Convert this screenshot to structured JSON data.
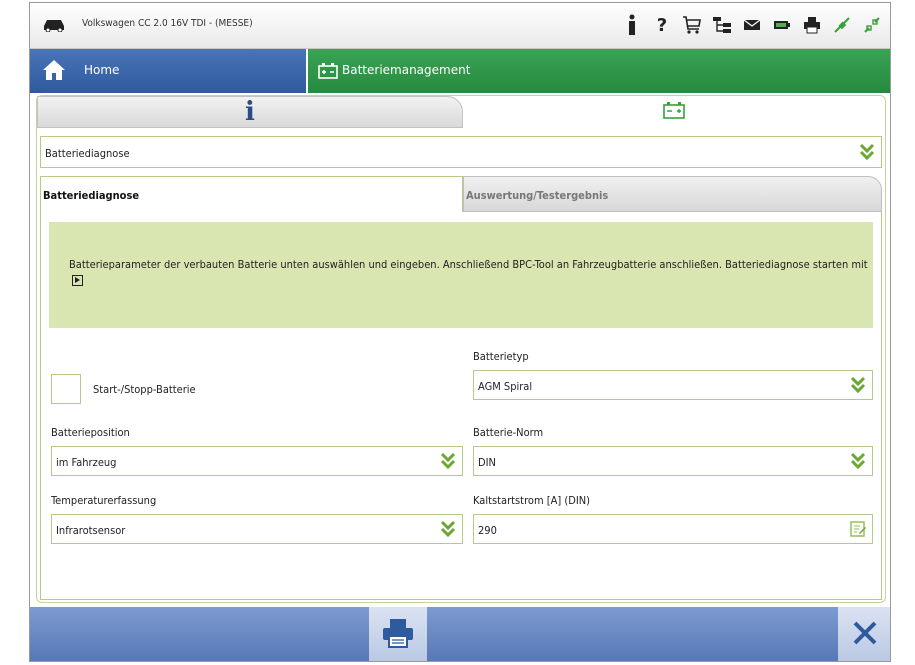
{
  "titlebar": {
    "vehicle": "Volkswagen CC 2.0 16V TDI - (MESSE)",
    "icons": [
      "person-icon",
      "help-icon",
      "cart-icon",
      "network-icon",
      "mail-icon",
      "battery-icon",
      "printer-icon",
      "connect-icon",
      "disconnect-icon"
    ]
  },
  "nav": {
    "home_label": "Home",
    "battery_label": "Batteriemanagement"
  },
  "dropdown_main": {
    "value": "Batteriediagnose"
  },
  "subtabs": {
    "active": "Batteriediagnose",
    "inactive": "Auswertung/Testergebnis"
  },
  "info": {
    "text": "Batterieparameter der verbauten Batterie unten auswählen und eingeben. Anschließend BPC-Tool an Fahrzeugbatterie anschließen. Batteriediagnose starten mit"
  },
  "form": {
    "start_stop_label": "Start-/Stopp-Batterie",
    "start_stop_checked": false,
    "battery_type_label": "Batterietyp",
    "battery_type_value": "AGM Spiral",
    "battery_position_label": "Batterieposition",
    "battery_position_value": "im Fahrzeug",
    "battery_norm_label": "Batterie-Norm",
    "battery_norm_value": "DIN",
    "temperature_label": "Temperaturerfassung",
    "temperature_value": "Infrarotsensor",
    "cold_start_label": "Kaltstartstrom [A] (DIN)",
    "cold_start_value": "290"
  },
  "colors": {
    "nav_blue": "#2f5a9e",
    "nav_green": "#268a3f",
    "accent_green": "#5a9e2a",
    "info_bg": "#d9e6b1",
    "bottom_blue": "#5677b5"
  }
}
